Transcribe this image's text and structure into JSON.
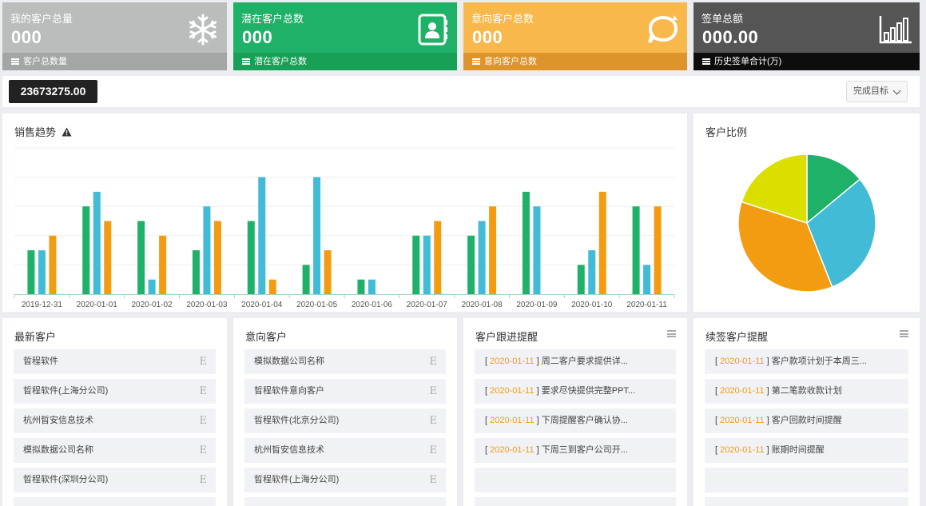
{
  "cards": [
    {
      "title": "我的客户总量",
      "value": "000",
      "footer": "客户总数量",
      "icon": "snowflake-icon",
      "top_color": "#b9bdbb",
      "bottom_color": "#a2a6a4"
    },
    {
      "title": "潜在客户总数",
      "value": "000",
      "footer": "潜在客户总数",
      "icon": "contacts-book-icon",
      "top_color": "#1fb167",
      "bottom_color": "#19a057"
    },
    {
      "title": "意向客户总数",
      "value": "000",
      "footer": "意向客户总数",
      "icon": "chat-bubble-icon",
      "top_color": "#f9b84b",
      "bottom_color": "#dd942b"
    },
    {
      "title": "签单总额",
      "value": "000.00",
      "footer": "历史签单合计(万)",
      "icon": "bar-chart-icon",
      "top_color": "#555555",
      "bottom_color": "#0d0d0d"
    }
  ],
  "summary": {
    "total": "23673275.00",
    "goal_button": "完成目标"
  },
  "sales_panel": {
    "title": "销售趋势"
  },
  "ratio_panel": {
    "title": "客户比例"
  },
  "chart_data": [
    {
      "type": "bar",
      "categories": [
        "2019-12-31",
        "2020-01-01",
        "2020-01-02",
        "2020-01-03",
        "2020-01-04",
        "2020-01-05",
        "2020-01-06",
        "2020-01-07",
        "2020-01-08",
        "2020-01-09",
        "2020-01-10",
        "2020-01-11"
      ],
      "series": [
        {
          "color": "#1fb167",
          "values": [
            3,
            6,
            5,
            3,
            5,
            2,
            1,
            4,
            4,
            7,
            2,
            6
          ]
        },
        {
          "color": "#41bbd6",
          "values": [
            3,
            7,
            1,
            6,
            8,
            8,
            1,
            4,
            5,
            6,
            3,
            2
          ]
        },
        {
          "color": "#f39c12",
          "values": [
            4,
            5,
            4,
            5,
            1,
            3,
            0,
            5,
            6,
            0,
            7,
            6
          ]
        }
      ],
      "ylim": [
        0,
        10
      ],
      "grid": true
    },
    {
      "type": "pie",
      "slices": [
        {
          "value": 14,
          "color": "#1fb167"
        },
        {
          "value": 30,
          "color": "#41bbd6"
        },
        {
          "value": 36,
          "color": "#f39c12"
        },
        {
          "value": 20,
          "color": "#dbdf00"
        }
      ]
    }
  ],
  "latest_customers": {
    "title": "最新客户",
    "items": [
      "晢程软件",
      "晢程软件(上海分公司)",
      "杭州晢安信息技术",
      "模拟数据公司名称",
      "晢程软件(深圳分公司)"
    ],
    "edit_glyph": "E"
  },
  "intent_customers": {
    "title": "意向客户",
    "items": [
      "模拟数据公司名称",
      "晢程软件意向客户",
      "晢程软件(北京分公司)",
      "杭州晢安信息技术",
      "晢程软件(上海分公司)"
    ],
    "edit_glyph": "E"
  },
  "followup": {
    "title": "客户跟进提醒",
    "items": [
      {
        "date": "2020-01-11",
        "text": "周二客户要求提供详..."
      },
      {
        "date": "2020-01-11",
        "text": "要求尽快提供完整PPT..."
      },
      {
        "date": "2020-01-11",
        "text": "下周提醒客户确认协..."
      },
      {
        "date": "2020-01-11",
        "text": "下周三到客户公司开..."
      }
    ]
  },
  "renewal": {
    "title": "续签客户提醒",
    "items": [
      {
        "date": "2020-01-11",
        "text": "客户款项计划于本周三..."
      },
      {
        "date": "2020-01-11",
        "text": "第二笔款收款计划"
      },
      {
        "date": "2020-01-11",
        "text": "客户回款时间提醒"
      },
      {
        "date": "2020-01-11",
        "text": "账期时间提醒"
      }
    ]
  }
}
